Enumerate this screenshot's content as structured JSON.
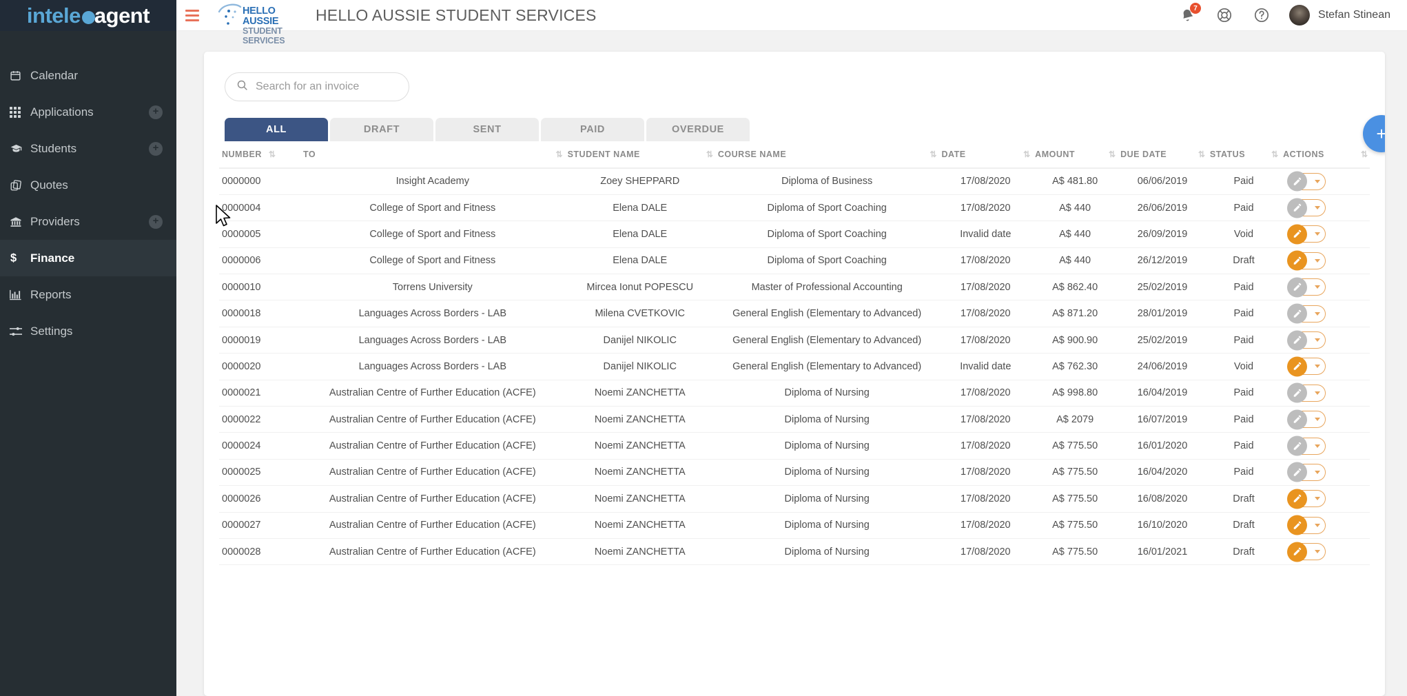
{
  "brand": {
    "part1": "intele",
    "part2": "agent"
  },
  "sidebar": {
    "items": [
      {
        "label": "Calendar",
        "icon": "calendar-icon",
        "plus": false,
        "active": false
      },
      {
        "label": "Applications",
        "icon": "grid-icon",
        "plus": true,
        "active": false
      },
      {
        "label": "Students",
        "icon": "graduation-cap-icon",
        "plus": true,
        "active": false
      },
      {
        "label": "Quotes",
        "icon": "copy-icon",
        "plus": false,
        "active": false
      },
      {
        "label": "Providers",
        "icon": "bank-icon",
        "plus": true,
        "active": false
      },
      {
        "label": "Finance",
        "icon": "dollar-icon",
        "plus": false,
        "active": true
      },
      {
        "label": "Reports",
        "icon": "bar-chart-icon",
        "plus": false,
        "active": false
      },
      {
        "label": "Settings",
        "icon": "sliders-icon",
        "plus": false,
        "active": false
      }
    ]
  },
  "topbar": {
    "menu_icon": "hamburger-icon",
    "company_logo_line1": "HELLO AUSSIE",
    "company_logo_line2": "STUDENT SERVICES",
    "title": "HELLO AUSSIE STUDENT SERVICES",
    "notification_count": "7",
    "support_icon": "lifebuoy-icon",
    "help_icon": "question-circle-icon",
    "user_name": "Stefan Stinean"
  },
  "search": {
    "placeholder": "Search for an invoice",
    "value": "",
    "icon": "search-icon"
  },
  "tabs": [
    {
      "label": "ALL",
      "active": true
    },
    {
      "label": "DRAFT",
      "active": false
    },
    {
      "label": "SENT",
      "active": false
    },
    {
      "label": "PAID",
      "active": false
    },
    {
      "label": "OVERDUE",
      "active": false
    }
  ],
  "table": {
    "columns": [
      {
        "key": "number",
        "label": "NUMBER"
      },
      {
        "key": "to",
        "label": "TO"
      },
      {
        "key": "student",
        "label": "STUDENT NAME"
      },
      {
        "key": "course",
        "label": "COURSE NAME"
      },
      {
        "key": "date",
        "label": "DATE"
      },
      {
        "key": "amount",
        "label": "AMOUNT"
      },
      {
        "key": "due",
        "label": "DUE DATE"
      },
      {
        "key": "status",
        "label": "STATUS"
      },
      {
        "key": "actions",
        "label": "ACTIONS"
      }
    ],
    "rows": [
      {
        "number": "0000000",
        "to": "Insight Academy",
        "student": "Zoey SHEPPARD",
        "course": "Diploma of Business",
        "date": "17/08/2020",
        "amount": "A$ 481.80",
        "due": "06/06/2019",
        "status": "Paid",
        "action_color": "gray"
      },
      {
        "number": "0000004",
        "to": "College of Sport and Fitness",
        "student": "Elena DALE",
        "course": "Diploma of Sport Coaching",
        "date": "17/08/2020",
        "amount": "A$ 440",
        "due": "26/06/2019",
        "status": "Paid",
        "action_color": "gray"
      },
      {
        "number": "0000005",
        "to": "College of Sport and Fitness",
        "student": "Elena DALE",
        "course": "Diploma of Sport Coaching",
        "date": "Invalid date",
        "amount": "A$ 440",
        "due": "26/09/2019",
        "status": "Void",
        "action_color": "orange"
      },
      {
        "number": "0000006",
        "to": "College of Sport and Fitness",
        "student": "Elena DALE",
        "course": "Diploma of Sport Coaching",
        "date": "17/08/2020",
        "amount": "A$ 440",
        "due": "26/12/2019",
        "status": "Draft",
        "action_color": "orange"
      },
      {
        "number": "0000010",
        "to": "Torrens University",
        "student": "Mircea Ionut POPESCU",
        "course": "Master of Professional Accounting",
        "date": "17/08/2020",
        "amount": "A$ 862.40",
        "due": "25/02/2019",
        "status": "Paid",
        "action_color": "gray"
      },
      {
        "number": "0000018",
        "to": "Languages Across Borders - LAB",
        "student": "Milena CVETKOVIC",
        "course": "General English (Elementary to Advanced)",
        "date": "17/08/2020",
        "amount": "A$ 871.20",
        "due": "28/01/2019",
        "status": "Paid",
        "action_color": "gray"
      },
      {
        "number": "0000019",
        "to": "Languages Across Borders - LAB",
        "student": "Danijel NIKOLIC",
        "course": "General English (Elementary to Advanced)",
        "date": "17/08/2020",
        "amount": "A$ 900.90",
        "due": "25/02/2019",
        "status": "Paid",
        "action_color": "gray"
      },
      {
        "number": "0000020",
        "to": "Languages Across Borders - LAB",
        "student": "Danijel NIKOLIC",
        "course": "General English (Elementary to Advanced)",
        "date": "Invalid date",
        "amount": "A$ 762.30",
        "due": "24/06/2019",
        "status": "Void",
        "action_color": "orange"
      },
      {
        "number": "0000021",
        "to": "Australian Centre of Further Education (ACFE)",
        "student": "Noemi ZANCHETTA",
        "course": "Diploma of Nursing",
        "date": "17/08/2020",
        "amount": "A$ 998.80",
        "due": "16/04/2019",
        "status": "Paid",
        "action_color": "gray"
      },
      {
        "number": "0000022",
        "to": "Australian Centre of Further Education (ACFE)",
        "student": "Noemi ZANCHETTA",
        "course": "Diploma of Nursing",
        "date": "17/08/2020",
        "amount": "A$ 2079",
        "due": "16/07/2019",
        "status": "Paid",
        "action_color": "gray"
      },
      {
        "number": "0000024",
        "to": "Australian Centre of Further Education (ACFE)",
        "student": "Noemi ZANCHETTA",
        "course": "Diploma of Nursing",
        "date": "17/08/2020",
        "amount": "A$ 775.50",
        "due": "16/01/2020",
        "status": "Paid",
        "action_color": "gray"
      },
      {
        "number": "0000025",
        "to": "Australian Centre of Further Education (ACFE)",
        "student": "Noemi ZANCHETTA",
        "course": "Diploma of Nursing",
        "date": "17/08/2020",
        "amount": "A$ 775.50",
        "due": "16/04/2020",
        "status": "Paid",
        "action_color": "gray"
      },
      {
        "number": "0000026",
        "to": "Australian Centre of Further Education (ACFE)",
        "student": "Noemi ZANCHETTA",
        "course": "Diploma of Nursing",
        "date": "17/08/2020",
        "amount": "A$ 775.50",
        "due": "16/08/2020",
        "status": "Draft",
        "action_color": "orange"
      },
      {
        "number": "0000027",
        "to": "Australian Centre of Further Education (ACFE)",
        "student": "Noemi ZANCHETTA",
        "course": "Diploma of Nursing",
        "date": "17/08/2020",
        "amount": "A$ 775.50",
        "due": "16/10/2020",
        "status": "Draft",
        "action_color": "orange"
      },
      {
        "number": "0000028",
        "to": "Australian Centre of Further Education (ACFE)",
        "student": "Noemi ZANCHETTA",
        "course": "Diploma of Nursing",
        "date": "17/08/2020",
        "amount": "A$ 775.50",
        "due": "16/01/2021",
        "status": "Draft",
        "action_color": "orange"
      }
    ]
  },
  "fab": {
    "icon": "plus-icon",
    "label": "+"
  },
  "colors": {
    "sidebar_bg": "#262e33",
    "brand_blue": "#5aa7d6",
    "tab_active": "#3c5584",
    "accent_orange": "#e99420",
    "hamburger": "#e8725a",
    "badge_red": "#e8502e",
    "fab_blue": "#4a90e2"
  }
}
